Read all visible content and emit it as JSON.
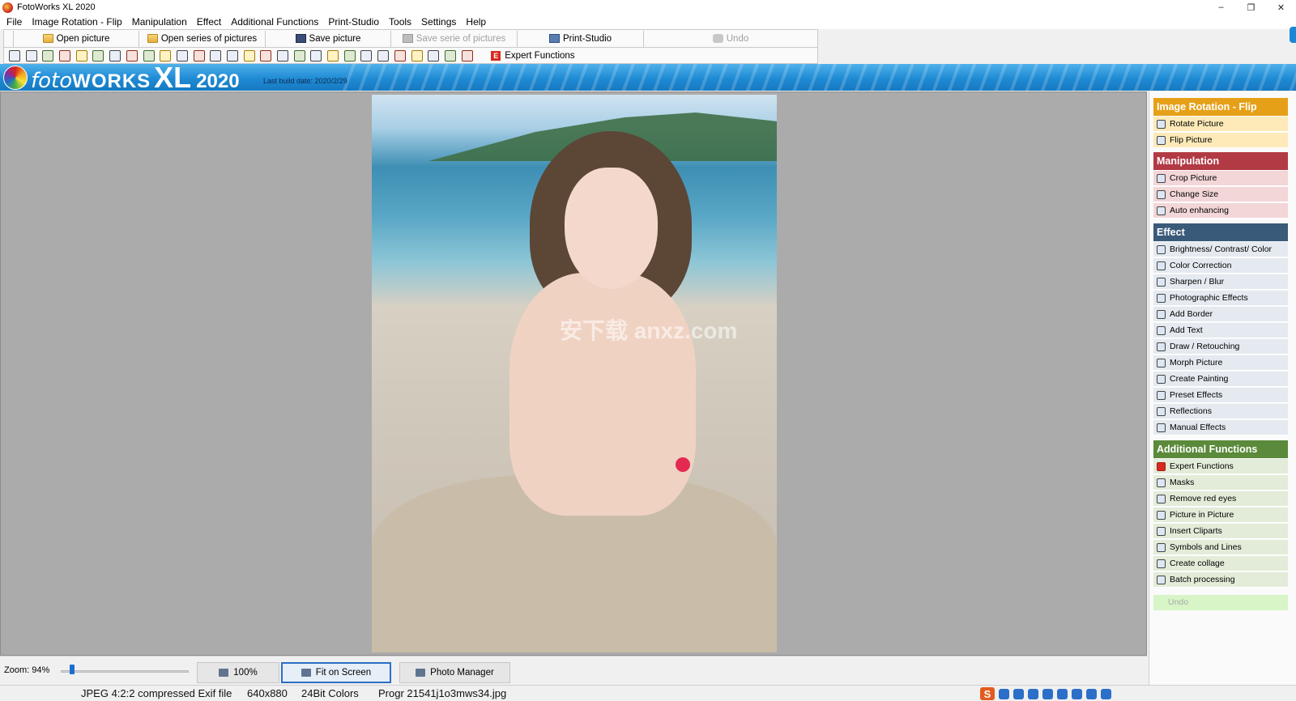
{
  "window": {
    "title": "FotoWorks XL 2020",
    "minimize": "–",
    "maximize": "❐",
    "close": "✕"
  },
  "menu": [
    "File",
    "Image Rotation - Flip",
    "Manipulation",
    "Effect",
    "Additional Functions",
    "Print-Studio",
    "Tools",
    "Settings",
    "Help"
  ],
  "toolbar": {
    "open_picture": "Open picture",
    "open_series": "Open series of pictures",
    "save_picture": "Save picture",
    "save_serie": "Save serie of pictures",
    "print_studio": "Print-Studio",
    "undo": "Undo",
    "expert_functions": "Expert Functions",
    "expert_badge": "E",
    "icon_names": [
      "rotate-left-icon",
      "rotate-right-icon",
      "rotate-ccw-icon",
      "rotate-cw-icon",
      "flip-icon",
      "mirror-icon",
      "auto-icon",
      "crop-icon",
      "resize-icon",
      "enhance-icon",
      "brightness-icon",
      "color-icon",
      "sharpen-icon",
      "photo-effects-icon",
      "border-icon",
      "text-icon",
      "draw-icon",
      "morph-icon",
      "painting-icon",
      "preset-icon",
      "reflections-icon",
      "manual-icon",
      "redeye-icon",
      "pip-icon",
      "cliparts-icon",
      "symbols-icon",
      "collage-icon",
      "batch-icon"
    ]
  },
  "banner": {
    "logo_foto": "foto",
    "logo_works": "WORKS",
    "logo_xl": "XL",
    "logo_year": "2020",
    "build_date": "Last build date: 2020/2/29"
  },
  "image": {
    "watermark": "安下载 anxz.com"
  },
  "bottom": {
    "zoom_label": "Zoom: 94%",
    "zoom_level": 94,
    "btn_100": "100%",
    "btn_fit": "Fit on Screen",
    "btn_manager": "Photo Manager"
  },
  "status": {
    "format": "JPEG 4:2:2 compressed Exif file",
    "size": "640x880",
    "colors": "24Bit Colors",
    "file": "Progr 21541j1o3mws34.jpg",
    "tray_s": "S"
  },
  "panel": {
    "rotation": {
      "title": "Image Rotation - Flip",
      "color": "#e6a018",
      "item_bg": "#fdeab8",
      "items": [
        "Rotate Picture",
        "Flip Picture"
      ]
    },
    "manipulation": {
      "title": "Manipulation",
      "color": "#b23a44",
      "item_bg": "#f3d6d8",
      "items": [
        "Crop Picture",
        "Change Size",
        "Auto enhancing"
      ]
    },
    "effect": {
      "title": "Effect",
      "color": "#3a5a7a",
      "item_bg": "#e4eaf0",
      "items": [
        "Brightness/ Contrast/ Color",
        "Color Correction",
        "Sharpen / Blur",
        "Photographic Effects",
        "Add Border",
        "Add Text",
        "Draw / Retouching",
        "Morph Picture",
        "Create Painting",
        "Preset Effects",
        "Reflections",
        "Manual Effects"
      ]
    },
    "additional": {
      "title": "Additional Functions",
      "color": "#5a8a3a",
      "item_bg": "#e3ecd9",
      "items": [
        "Expert Functions",
        "Masks",
        "Remove red eyes",
        "Picture in Picture",
        "Insert Cliparts",
        "Symbols and Lines",
        "Create collage",
        "Batch processing"
      ]
    },
    "undo": "Undo"
  }
}
